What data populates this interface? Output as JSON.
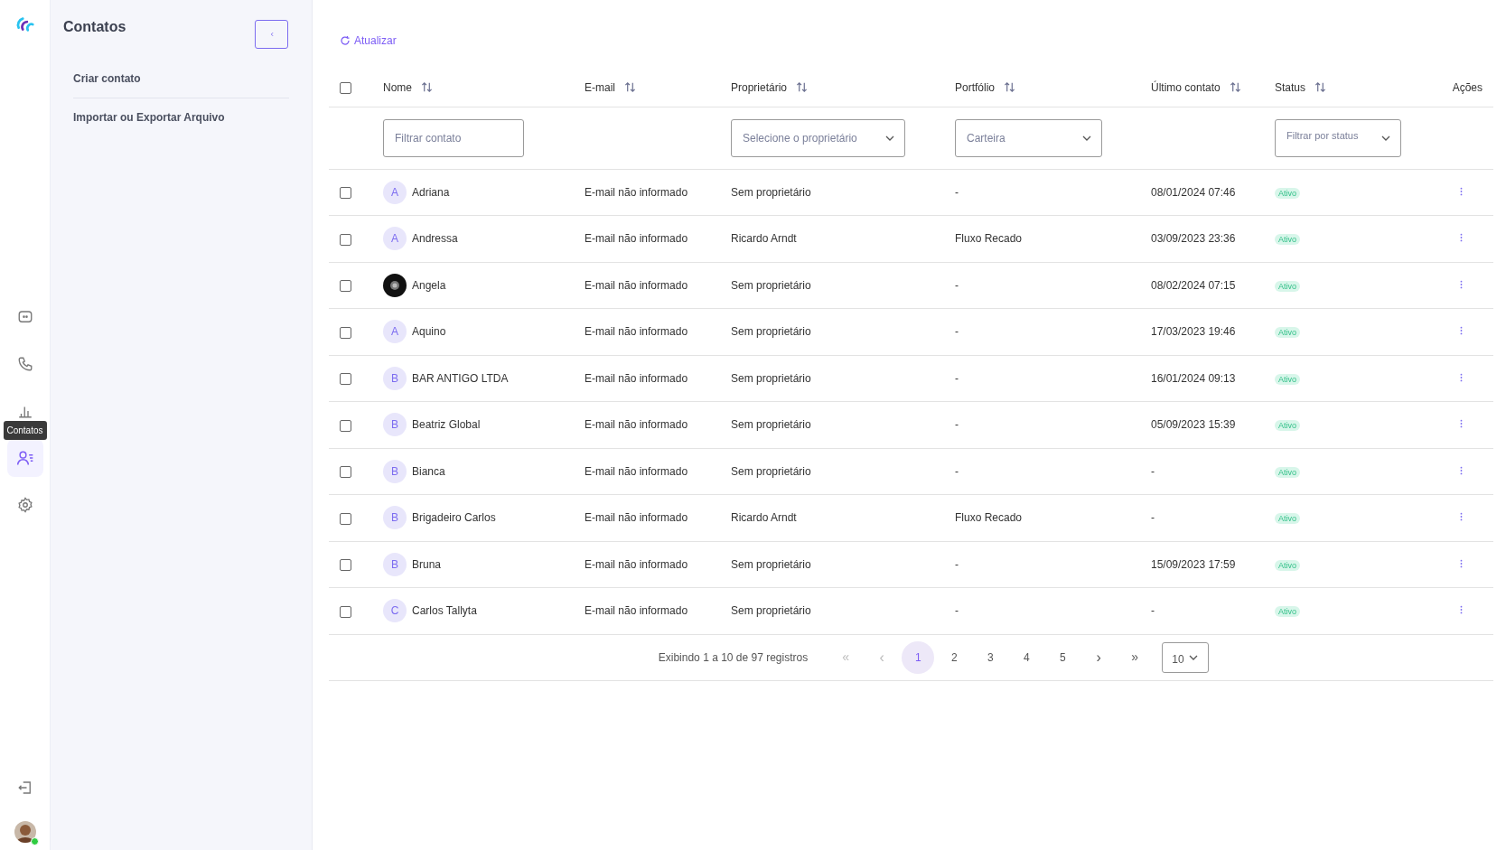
{
  "nav": {
    "items": [
      {
        "kind": "chat",
        "selected": false
      },
      {
        "kind": "phone",
        "selected": false
      },
      {
        "kind": "chart",
        "selected": false
      },
      {
        "kind": "contacts",
        "selected": true
      },
      {
        "kind": "settings",
        "selected": false
      }
    ],
    "tooltip": "Contatos",
    "user": {
      "online": true
    }
  },
  "panel": {
    "title": "Contatos",
    "items": [
      "Criar contato",
      "Importar ou Exportar Arquivo"
    ]
  },
  "refresh": "Atualizar",
  "table": {
    "select_all": {
      "checked": false
    },
    "columns": [
      {
        "label": "Nome",
        "sortable": true
      },
      {
        "label": "E-mail",
        "sortable": true
      },
      {
        "label": "Proprietário",
        "sortable": true
      },
      {
        "label": "Portfólio",
        "sortable": true
      },
      {
        "label": "Último contato",
        "sortable": true
      },
      {
        "label": "Status",
        "sortable": true
      },
      {
        "label": "Ações",
        "sortable": false
      }
    ],
    "filters": {
      "name": {
        "placeholder": "Filtrar contato"
      },
      "owner": {
        "placeholder": "Selecione o proprietário"
      },
      "portfolio": {
        "placeholder": "Carteira"
      },
      "status": {
        "placeholder": "Filtrar por status"
      }
    },
    "rows": [
      {
        "avatar": {
          "kind": "letter",
          "letter": "A"
        },
        "name": "Adriana",
        "email": "E-mail não informado",
        "owner": "Sem proprietário",
        "portfolio": "-",
        "last_contact": "08/01/2024 07:46",
        "status": "Ativo",
        "checked": false
      },
      {
        "avatar": {
          "kind": "letter",
          "letter": "A"
        },
        "name": "Andressa",
        "email": "E-mail não informado",
        "owner": "Ricardo Arndt",
        "portfolio": "Fluxo Recado",
        "last_contact": "03/09/2023 23:36",
        "status": "Ativo",
        "checked": false
      },
      {
        "name": "Angela",
        "email": "E-mail não informado",
        "owner": "Sem proprietário",
        "portfolio": "-",
        "last_contact": "08/02/2024 07:15",
        "status": "Ativo",
        "checked": false
      },
      {
        "avatar": {
          "kind": "letter",
          "letter": "A"
        },
        "name": "Aquino",
        "email": "E-mail não informado",
        "owner": "Sem proprietário",
        "portfolio": "-",
        "last_contact": "17/03/2023 19:46",
        "status": "Ativo",
        "checked": false
      },
      {
        "avatar": {
          "kind": "letter",
          "letter": "B"
        },
        "name": "BAR ANTIGO LTDA",
        "email": "E-mail não informado",
        "owner": "Sem proprietário",
        "portfolio": "-",
        "last_contact": "16/01/2024 09:13",
        "status": "Ativo",
        "checked": false
      },
      {
        "avatar": {
          "kind": "letter",
          "letter": "B"
        },
        "name": "Beatriz Global",
        "email": "E-mail não informado",
        "owner": "Sem proprietário",
        "portfolio": "-",
        "last_contact": "05/09/2023 15:39",
        "status": "Ativo",
        "checked": false
      },
      {
        "avatar": {
          "kind": "letter",
          "letter": "B"
        },
        "name": "Bianca",
        "email": "E-mail não informado",
        "owner": "Sem proprietário",
        "portfolio": "-",
        "last_contact": "-",
        "status": "Ativo",
        "checked": false
      },
      {
        "avatar": {
          "kind": "letter",
          "letter": "B"
        },
        "name": "Brigadeiro Carlos",
        "email": "E-mail não informado",
        "owner": "Ricardo Arndt",
        "portfolio": "Fluxo Recado",
        "last_contact": "-",
        "status": "Ativo",
        "checked": false
      },
      {
        "avatar": {
          "kind": "letter",
          "letter": "B"
        },
        "name": "Bruna",
        "email": "E-mail não informado",
        "owner": "Sem proprietário",
        "portfolio": "-",
        "last_contact": "15/09/2023 17:59",
        "status": "Ativo",
        "checked": false
      },
      {
        "avatar": {
          "kind": "letter",
          "letter": "C"
        },
        "name": "Carlos Tallyta",
        "email": "E-mail não informado",
        "owner": "Sem proprietário",
        "portfolio": "-",
        "last_contact": "-",
        "status": "Ativo",
        "checked": false
      }
    ]
  },
  "pagination": {
    "summary": "Exibindo 1 a 10 de 97 registros",
    "first": "«",
    "prev": "‹",
    "pages": [
      {
        "label": "1",
        "selected": true
      },
      {
        "label": "2",
        "selected": false
      },
      {
        "label": "3",
        "selected": false
      },
      {
        "label": "4",
        "selected": false
      },
      {
        "label": "5",
        "selected": false
      }
    ],
    "next": "›",
    "last": "»",
    "page_size": "10"
  }
}
